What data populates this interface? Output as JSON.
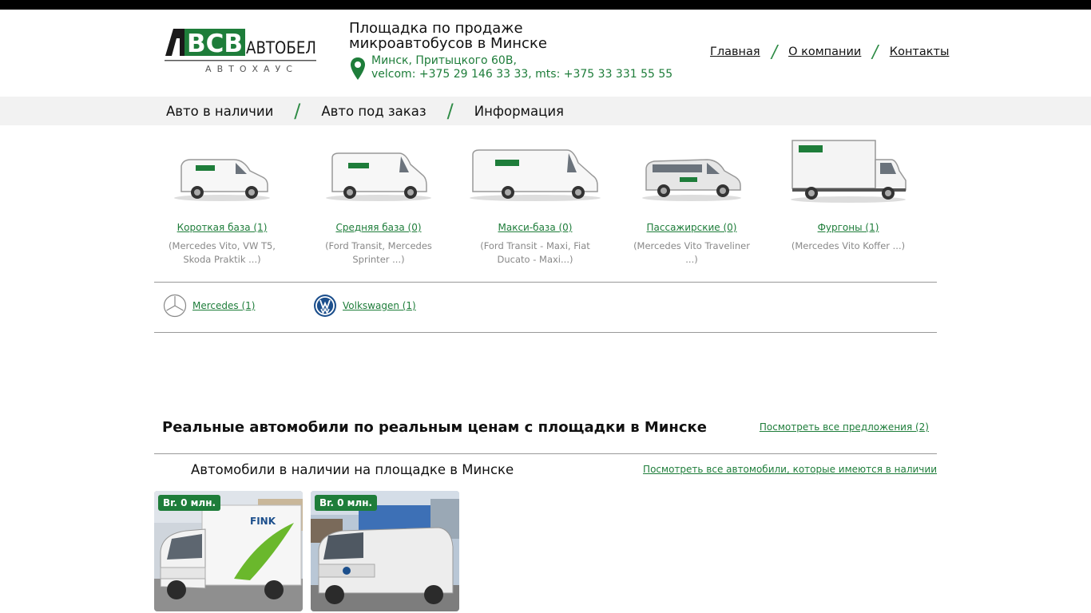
{
  "header": {
    "logo_letters": "BCB",
    "logo_name": "АВТОБЕЛ",
    "logo_sub": "АВТОХАУС",
    "tagline": "Площадка по продаже микроавтобусов в Минске",
    "address_line1": "Минск, Притыцкого 60В,",
    "address_line2": "velcom: +375 29 146 33 33, mts: +375 33 331 55 55",
    "nav": [
      "Главная",
      "О компании",
      "Контакты"
    ]
  },
  "menu": [
    "Авто в наличии",
    "Авто под заказ",
    "Информация"
  ],
  "categories": [
    {
      "name": "Короткая база (1)",
      "desc": "(Mercedes Vito, VW T5, Skoda Praktik ...)"
    },
    {
      "name": "Средняя база (0)",
      "desc": "(Ford Transit, Mercedes Sprinter ...)"
    },
    {
      "name": "Макси-база (0)",
      "desc": "(Ford Transit - Maxi, Fiat Ducato - Maxi...)"
    },
    {
      "name": "Пассажирские (0)",
      "desc": "(Mercedes Vito Traveliner ...)"
    },
    {
      "name": "Фургоны (1)",
      "desc": "(Mercedes Vito Koffer ...)"
    }
  ],
  "brands": [
    {
      "name": "Mercedes (1)"
    },
    {
      "name": "Volkswagen (1)"
    }
  ],
  "section": {
    "title": "Реальные автомобили по реальным ценам с площадки в Минске",
    "view_all": "Посмотреть все предложения (2)",
    "subtitle": "Автомобили в наличии на площадке в Минске",
    "view_available": "Посмотреть все автомобили, которые имеются в наличии"
  },
  "cards": [
    {
      "price": "Br. 0 млн.",
      "truck_brand": "FINK"
    },
    {
      "price": "Br. 0 млн."
    }
  ],
  "colors": {
    "accent": "#1e7d3a",
    "menu_bg": "#f2f2f2"
  }
}
